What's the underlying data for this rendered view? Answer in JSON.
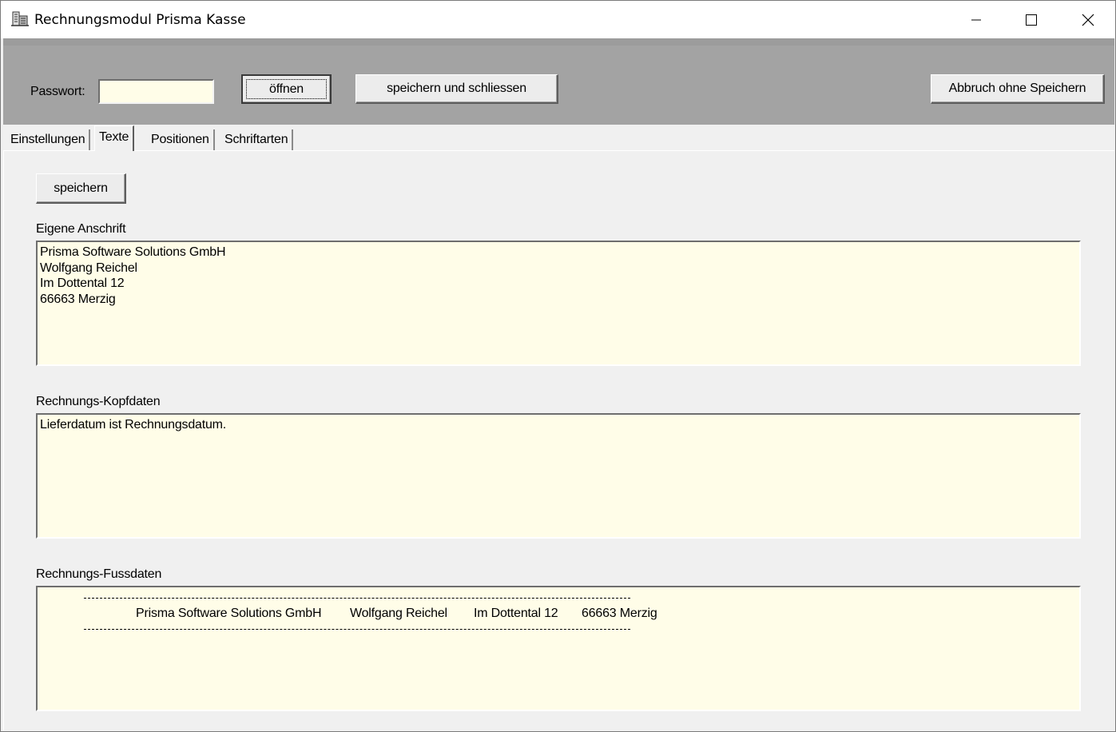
{
  "window": {
    "title": "Rechnungsmodul Prisma Kasse",
    "icon": "building-icon"
  },
  "toolbar": {
    "password_label": "Passwort:",
    "password_value": "",
    "open_label": "öffnen",
    "save_close_label": "speichern und schliessen",
    "abort_label": "Abbruch ohne Speichern"
  },
  "tabs": [
    {
      "label": "Einstellungen",
      "active": false
    },
    {
      "label": "Texte",
      "active": true
    },
    {
      "label": "Positionen",
      "active": false
    },
    {
      "label": "Schriftarten",
      "active": false
    }
  ],
  "texte": {
    "save_label": "speichern",
    "address": {
      "label": "Eigene Anschrift",
      "value": "Prisma Software Solutions GmbH\nWolfgang Reichel\nIm Dottental 12\n66663 Merzig"
    },
    "header": {
      "label": "Rechnungs-Kopfdaten",
      "value": "Lieferdatum ist Rechnungsdatum."
    },
    "footer": {
      "label": "Rechnungs-Fussdaten",
      "items": [
        "Prisma Software Solutions GmbH",
        "Wolfgang Reichel",
        "Im Dottental 12",
        "66663 Merzig"
      ]
    }
  },
  "colors": {
    "field_background": "#fffde8",
    "toolbar_background": "#a3a3a3",
    "window_background": "#f0f0f0"
  }
}
